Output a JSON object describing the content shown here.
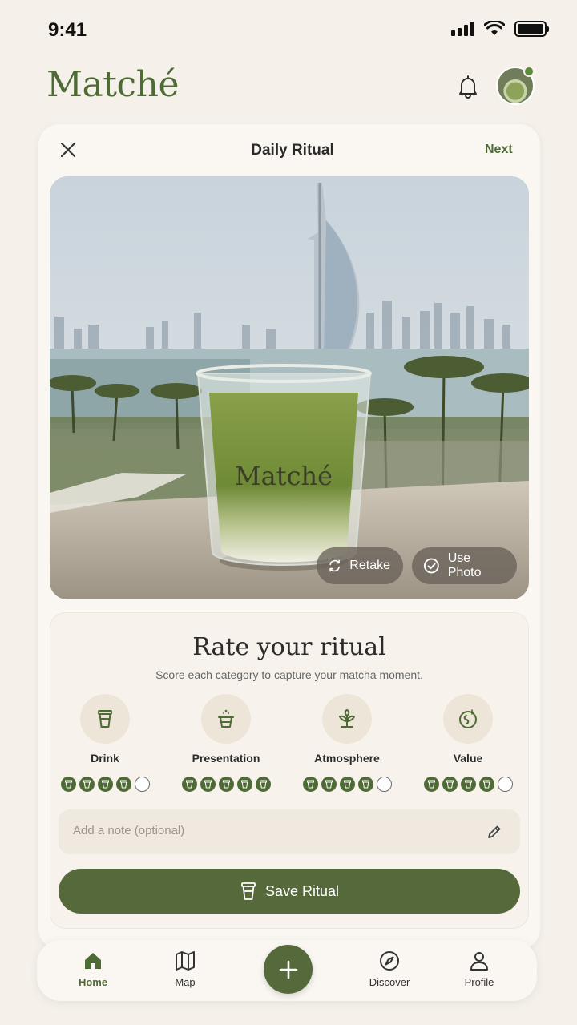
{
  "status_bar": {
    "time": "9:41"
  },
  "app": {
    "name": "Matché"
  },
  "card": {
    "title": "Daily Ritual",
    "next_label": "Next"
  },
  "photo": {
    "cup_brand": "Matché",
    "retake_label": "Retake",
    "use_photo_label": "Use Photo"
  },
  "rating": {
    "title": "Rate your ritual",
    "subtitle": "Score each category to capture your matcha moment.",
    "categories": [
      {
        "label": "Drink",
        "icon": "cup-icon",
        "score": 4,
        "max": 5
      },
      {
        "label": "Presentation",
        "icon": "presentation-icon",
        "score": 5,
        "max": 5
      },
      {
        "label": "Atmosphere",
        "icon": "plant-icon",
        "score": 4,
        "max": 5
      },
      {
        "label": "Value",
        "icon": "value-icon",
        "score": 4,
        "max": 5
      }
    ],
    "note_placeholder": "Add a note (optional)",
    "save_label": "Save Ritual"
  },
  "nav": {
    "items": [
      {
        "label": "Home",
        "icon": "home-icon",
        "active": true
      },
      {
        "label": "Map",
        "icon": "map-icon",
        "active": false
      },
      {
        "label": "Discover",
        "icon": "compass-icon",
        "active": false
      },
      {
        "label": "Profile",
        "icon": "profile-icon",
        "active": false
      }
    ],
    "add_icon": "plus-icon"
  },
  "colors": {
    "brand": "#4f6b35",
    "button": "#55693a",
    "background": "#f5f1ea"
  }
}
